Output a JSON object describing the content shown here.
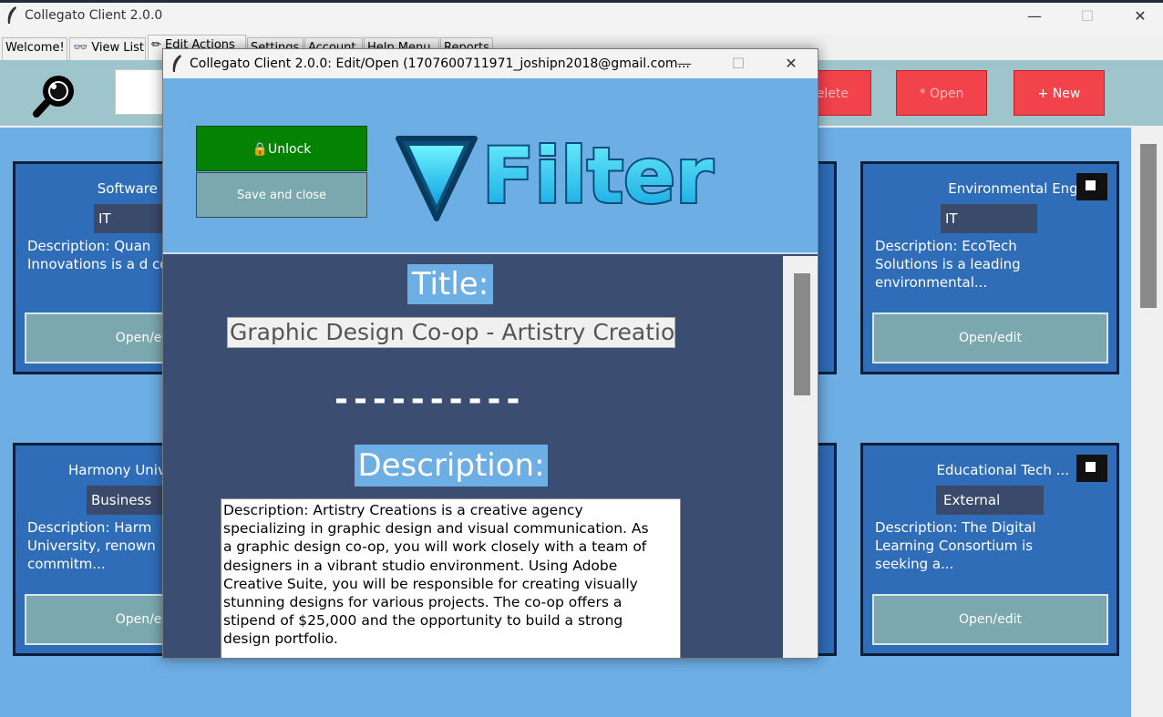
{
  "window": {
    "title": "Collegato Client 2.0.0",
    "minimize": "—",
    "maximize": "☐",
    "close": "✕"
  },
  "tabs": [
    {
      "label": "Welcome!"
    },
    {
      "label": "👓 View List"
    },
    {
      "label": "✏ Edit Actions"
    },
    {
      "label": "Settings"
    },
    {
      "label": "Account"
    },
    {
      "label": "Help Menu"
    },
    {
      "label": "Reports"
    }
  ],
  "toolbar": {
    "delete_label": "Delete",
    "open_label": "* Open",
    "new_label": "+ New",
    "accent": "#f2424a"
  },
  "cards": [
    {
      "title": "Software Dev",
      "tag": "IT",
      "description": "Description: Quan Innovations is a d compan...",
      "button": "Open/ed"
    },
    {
      "title": "Environmental Eng...",
      "tag": "IT",
      "description": "Description: EcoTech Solutions is a leading environmental...",
      "button": "Open/edit"
    },
    {
      "title": "Harmony Univ",
      "tag": "Business",
      "description": "Description: Harm University, renown commitm...",
      "button": "Open/ed"
    },
    {
      "title": "Educational Tech ...",
      "tag": "External",
      "description": "Description: The Digital Learning Consortium is seeking a...",
      "button": "Open/edit"
    }
  ],
  "dialog": {
    "title": "Collegato Client 2.0.0: Edit/Open (1707600711971_joshipn2018@gmail.com...",
    "minimize": "—",
    "maximize": "☐",
    "close": "✕",
    "unlock_label": "🔒Unlock",
    "save_close_label": "Save and close",
    "logo_text": "Filter",
    "title_label": "Title:",
    "title_value": "Graphic Design Co-op - Artistry Creations",
    "divider": "----------",
    "description_label": "Description:",
    "description_value": "Description: Artistry Creations is a creative agency\nspecializing in graphic design and visual communication. As\na graphic design co-op, you will work closely with a team of\ndesigners in a vibrant studio environment. Using Adobe\nCreative Suite, you will be responsible for creating visually\nstunning designs for various projects. The co-op offers a\nstipend of $25,000 and the opportunity to build a strong\ndesign portfolio."
  },
  "icons": {
    "app": "feather-icon",
    "search": "magnifier-icon",
    "filter": "filter-funnel-icon",
    "lock": "lock-icon"
  },
  "colors": {
    "board": "#6daee4",
    "card": "#2f6db8",
    "unlock": "#038203",
    "secondary_button": "#7aa8ae"
  }
}
